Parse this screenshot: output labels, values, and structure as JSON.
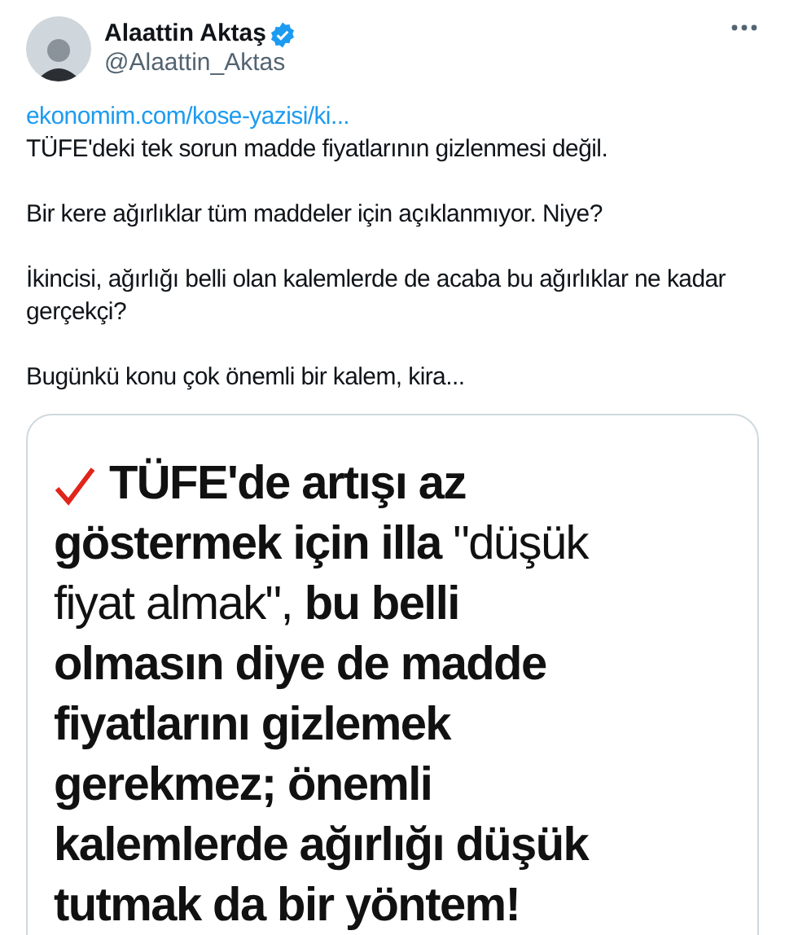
{
  "author": {
    "name": "Alaattin Aktaş",
    "handle": "@Alaattin_Aktas",
    "verified": true
  },
  "link": "ekonomim.com/kose-yazisi/ki...",
  "paragraphs": [
    "TÜFE'deki tek sorun madde fiyatlarının gizlenmesi değil.",
    "Bir kere ağırlıklar tüm maddeler için açıklanmıyor. Niye?",
    "İkincisi, ağırlığı belli olan kalemlerde de acaba bu ağırlıklar ne kadar gerçekçi?",
    "Bugünkü konu çok önemli bir kalem, kira..."
  ],
  "image_lines": [
    "**TÜFE'de artışı az**",
    "**göstermek için illa** \"düşük",
    "fiyat almak\", **bu belli**",
    "**olmasın diye de madde**",
    "**fiyatlarını gizlemek**",
    "**gerekmez; önemli**",
    "**kalemlerde ağırlığı düşük**",
    "**tutmak da bir yöntem!**"
  ]
}
